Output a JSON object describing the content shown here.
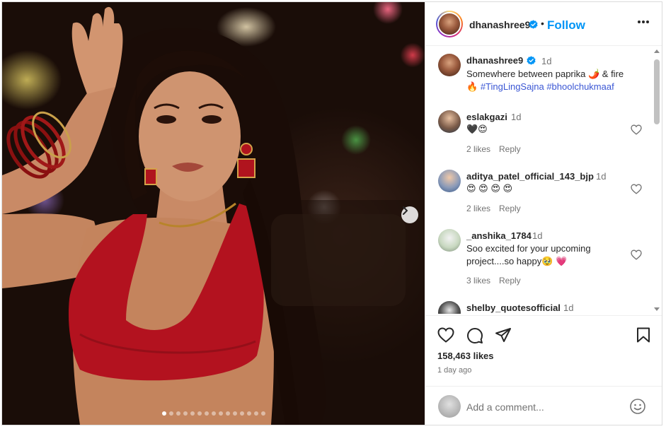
{
  "post": {
    "username": "dhanashree9",
    "follow_label": "Follow",
    "separator": "•",
    "caption": {
      "time": "1d",
      "text_1": "Somewhere between paprika 🌶️  & fire",
      "text_2": "🔥",
      "hashtag_1": "#TingLingSajna",
      "hashtag_2": "#bhoolchukmaaf"
    },
    "likes": "158,463 likes",
    "posted": "1 day ago",
    "slides": {
      "count": 15,
      "active_index": 0
    }
  },
  "comments": [
    {
      "username": "eslakgazi",
      "time": "1d",
      "text": "🖤😍",
      "likes": "2 likes",
      "reply": "Reply"
    },
    {
      "username": "aditya_patel_official_143_bjp",
      "time": "1d",
      "text": "😍 😍 😍 😍",
      "likes": "2 likes",
      "reply": "Reply"
    },
    {
      "username": "_anshika_1784",
      "time": "1d",
      "text_1": "Soo excited for your upcoming",
      "text_2": "project....so happy🥹 💗",
      "likes": "3 likes",
      "reply": "Reply"
    },
    {
      "username": "shelby_quotesofficial",
      "time": "1d"
    }
  ],
  "add_comment": {
    "placeholder": "Add a comment..."
  },
  "colors": {
    "accent": "#0095f6",
    "hashtag": "#3a56d4",
    "text": "#262626",
    "muted": "#737373",
    "dress": "#b3121f"
  },
  "icons": [
    "verified-icon",
    "more-icon",
    "heart-icon",
    "comment-icon",
    "share-icon",
    "save-icon",
    "emoji-icon",
    "chevron-right-icon"
  ]
}
